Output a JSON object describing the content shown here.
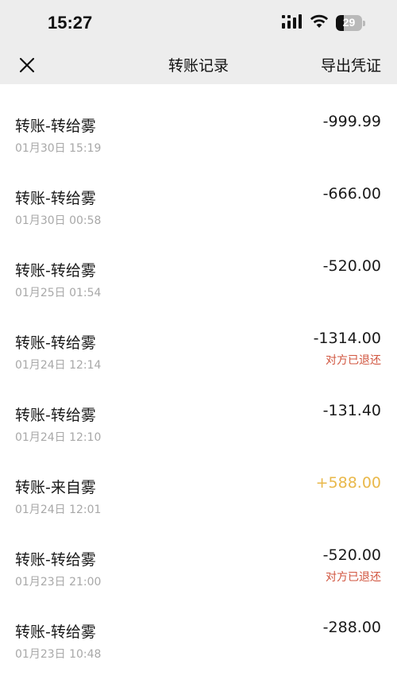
{
  "status_bar": {
    "time": "15:27",
    "battery_level": "29",
    "battery_fraction": 0.29,
    "icons": [
      "cellular-signal-icon",
      "wifi-icon",
      "battery-icon"
    ]
  },
  "nav": {
    "title": "转账记录",
    "export_label": "导出凭证",
    "close_icon": "close-icon"
  },
  "colors": {
    "header_bg": "#ededed",
    "text": "#1a1a1a",
    "muted": "#a8a8a8",
    "income": "#e9b84a",
    "note": "#d1553f"
  },
  "transactions": [
    {
      "title": "转账-转给雾",
      "time": "01月30日 15:19",
      "amount": "-999.99",
      "note": ""
    },
    {
      "title": "转账-转给雾",
      "time": "01月30日 00:58",
      "amount": "-666.00",
      "note": ""
    },
    {
      "title": "转账-转给雾",
      "time": "01月25日 01:54",
      "amount": "-520.00",
      "note": ""
    },
    {
      "title": "转账-转给雾",
      "time": "01月24日 12:14",
      "amount": "-1314.00",
      "note": "对方已退还"
    },
    {
      "title": "转账-转给雾",
      "time": "01月24日 12:10",
      "amount": "-131.40",
      "note": ""
    },
    {
      "title": "转账-来自雾",
      "time": "01月24日 12:01",
      "amount": "+588.00",
      "note": ""
    },
    {
      "title": "转账-转给雾",
      "time": "01月23日 21:00",
      "amount": "-520.00",
      "note": "对方已退还"
    },
    {
      "title": "转账-转给雾",
      "time": "01月23日 10:48",
      "amount": "-288.00",
      "note": ""
    }
  ]
}
